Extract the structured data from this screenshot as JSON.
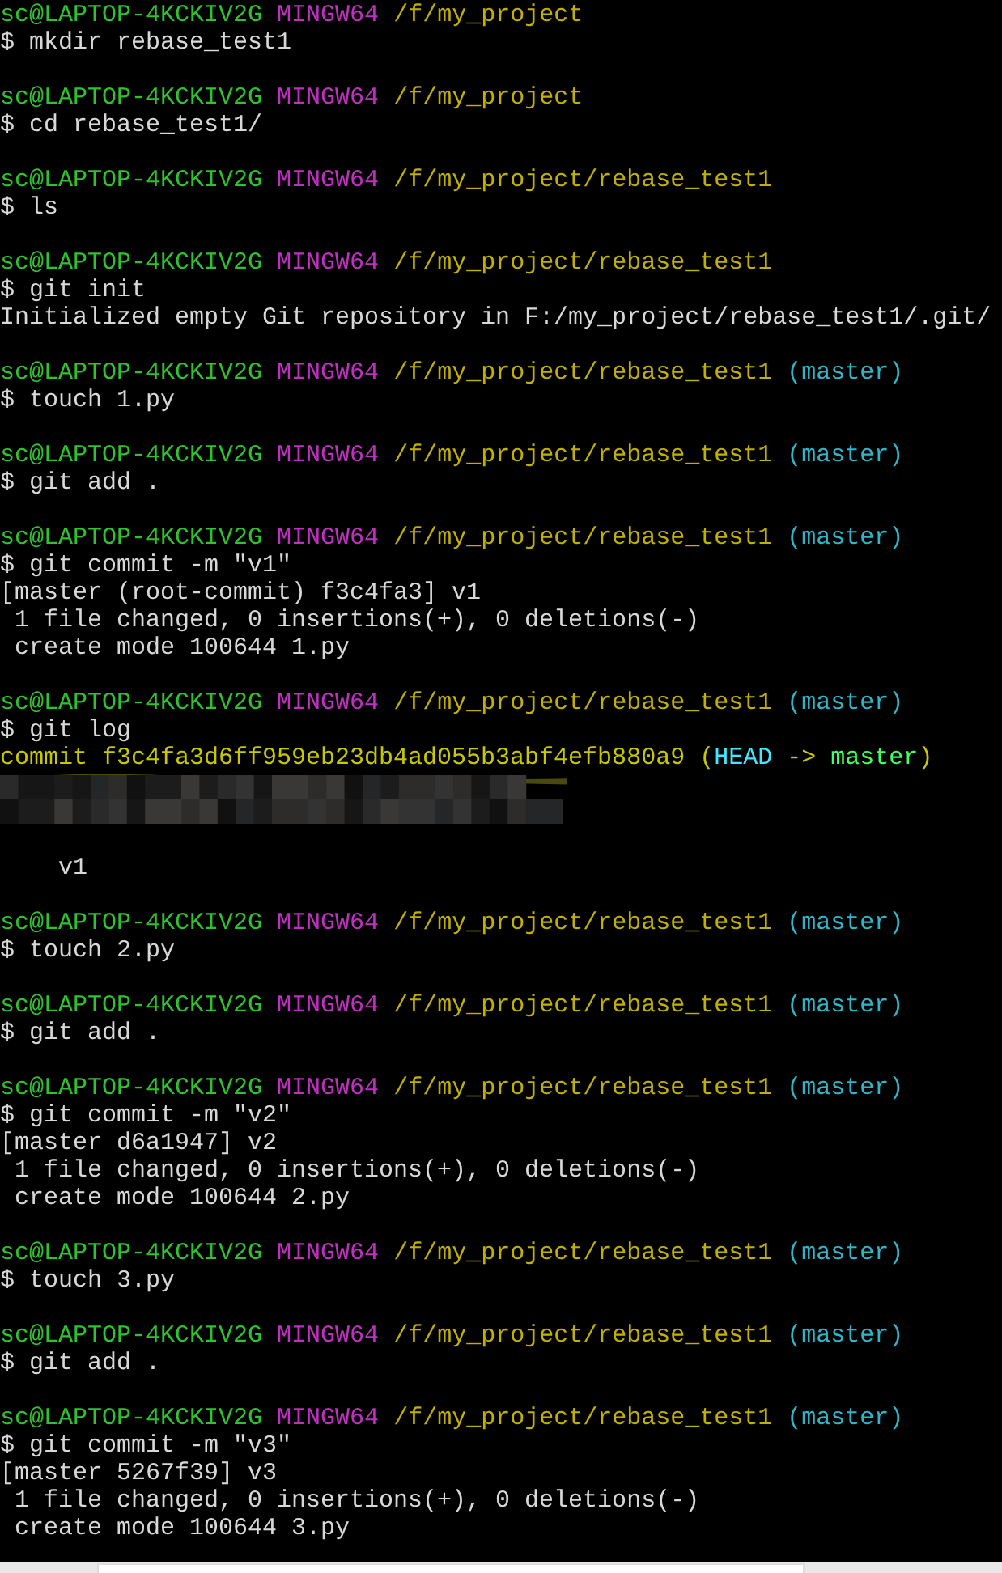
{
  "terminal": {
    "blocks": [
      {
        "prompt": {
          "user_host": "sc@LAPTOP-4KCKIV2G",
          "system": "MINGW64",
          "path": "/f/my_project"
        },
        "command": "$ mkdir rebase_test1"
      },
      {
        "prompt": {
          "user_host": "sc@LAPTOP-4KCKIV2G",
          "system": "MINGW64",
          "path": "/f/my_project"
        },
        "command": "$ cd rebase_test1/"
      },
      {
        "prompt": {
          "user_host": "sc@LAPTOP-4KCKIV2G",
          "system": "MINGW64",
          "path": "/f/my_project/rebase_test1"
        },
        "command": "$ ls"
      },
      {
        "prompt": {
          "user_host": "sc@LAPTOP-4KCKIV2G",
          "system": "MINGW64",
          "path": "/f/my_project/rebase_test1"
        },
        "command": "$ git init",
        "output": [
          {
            "kind": "text",
            "text": "Initialized empty Git repository in F:/my_project/rebase_test1/.git/"
          }
        ]
      },
      {
        "prompt": {
          "user_host": "sc@LAPTOP-4KCKIV2G",
          "system": "MINGW64",
          "path": "/f/my_project/rebase_test1",
          "branch": "(master)"
        },
        "command": "$ touch 1.py"
      },
      {
        "prompt": {
          "user_host": "sc@LAPTOP-4KCKIV2G",
          "system": "MINGW64",
          "path": "/f/my_project/rebase_test1",
          "branch": "(master)"
        },
        "command": "$ git add ."
      },
      {
        "prompt": {
          "user_host": "sc@LAPTOP-4KCKIV2G",
          "system": "MINGW64",
          "path": "/f/my_project/rebase_test1",
          "branch": "(master)"
        },
        "command": "$ git commit -m \"v1\"",
        "output": [
          {
            "kind": "text",
            "text": "[master (root-commit) f3c4fa3] v1"
          },
          {
            "kind": "text",
            "text": " 1 file changed, 0 insertions(+), 0 deletions(-)"
          },
          {
            "kind": "text",
            "text": " create mode 100644 1.py"
          }
        ]
      },
      {
        "prompt": {
          "user_host": "sc@LAPTOP-4KCKIV2G",
          "system": "MINGW64",
          "path": "/f/my_project/rebase_test1",
          "branch": "(master)"
        },
        "command": "$ git log",
        "output": [
          {
            "kind": "commit",
            "hash": "commit f3c4fa3d6ff959eb23db4ad055b3abf4efb880a9",
            "open": "(",
            "head": "HEAD",
            "arrow": "->",
            "branch": "master",
            "close": ")"
          },
          {
            "kind": "redacted"
          },
          {
            "kind": "blank"
          },
          {
            "kind": "message",
            "text": "v1"
          }
        ]
      },
      {
        "prompt": {
          "user_host": "sc@LAPTOP-4KCKIV2G",
          "system": "MINGW64",
          "path": "/f/my_project/rebase_test1",
          "branch": "(master)"
        },
        "command": "$ touch 2.py"
      },
      {
        "prompt": {
          "user_host": "sc@LAPTOP-4KCKIV2G",
          "system": "MINGW64",
          "path": "/f/my_project/rebase_test1",
          "branch": "(master)"
        },
        "command": "$ git add ."
      },
      {
        "prompt": {
          "user_host": "sc@LAPTOP-4KCKIV2G",
          "system": "MINGW64",
          "path": "/f/my_project/rebase_test1",
          "branch": "(master)"
        },
        "command": "$ git commit -m \"v2\"",
        "output": [
          {
            "kind": "text",
            "text": "[master d6a1947] v2"
          },
          {
            "kind": "text",
            "text": " 1 file changed, 0 insertions(+), 0 deletions(-)"
          },
          {
            "kind": "text",
            "text": " create mode 100644 2.py"
          }
        ]
      },
      {
        "prompt": {
          "user_host": "sc@LAPTOP-4KCKIV2G",
          "system": "MINGW64",
          "path": "/f/my_project/rebase_test1",
          "branch": "(master)"
        },
        "command": "$ touch 3.py"
      },
      {
        "prompt": {
          "user_host": "sc@LAPTOP-4KCKIV2G",
          "system": "MINGW64",
          "path": "/f/my_project/rebase_test1",
          "branch": "(master)"
        },
        "command": "$ git add ."
      },
      {
        "prompt": {
          "user_host": "sc@LAPTOP-4KCKIV2G",
          "system": "MINGW64",
          "path": "/f/my_project/rebase_test1",
          "branch": "(master)"
        },
        "command": "$ git commit -m \"v3\"",
        "output": [
          {
            "kind": "text",
            "text": "[master 5267f39] v3"
          },
          {
            "kind": "text",
            "text": " 1 file changed, 0 insertions(+), 0 deletions(-)"
          },
          {
            "kind": "text",
            "text": " create mode 100644 3.py"
          }
        ]
      }
    ]
  }
}
